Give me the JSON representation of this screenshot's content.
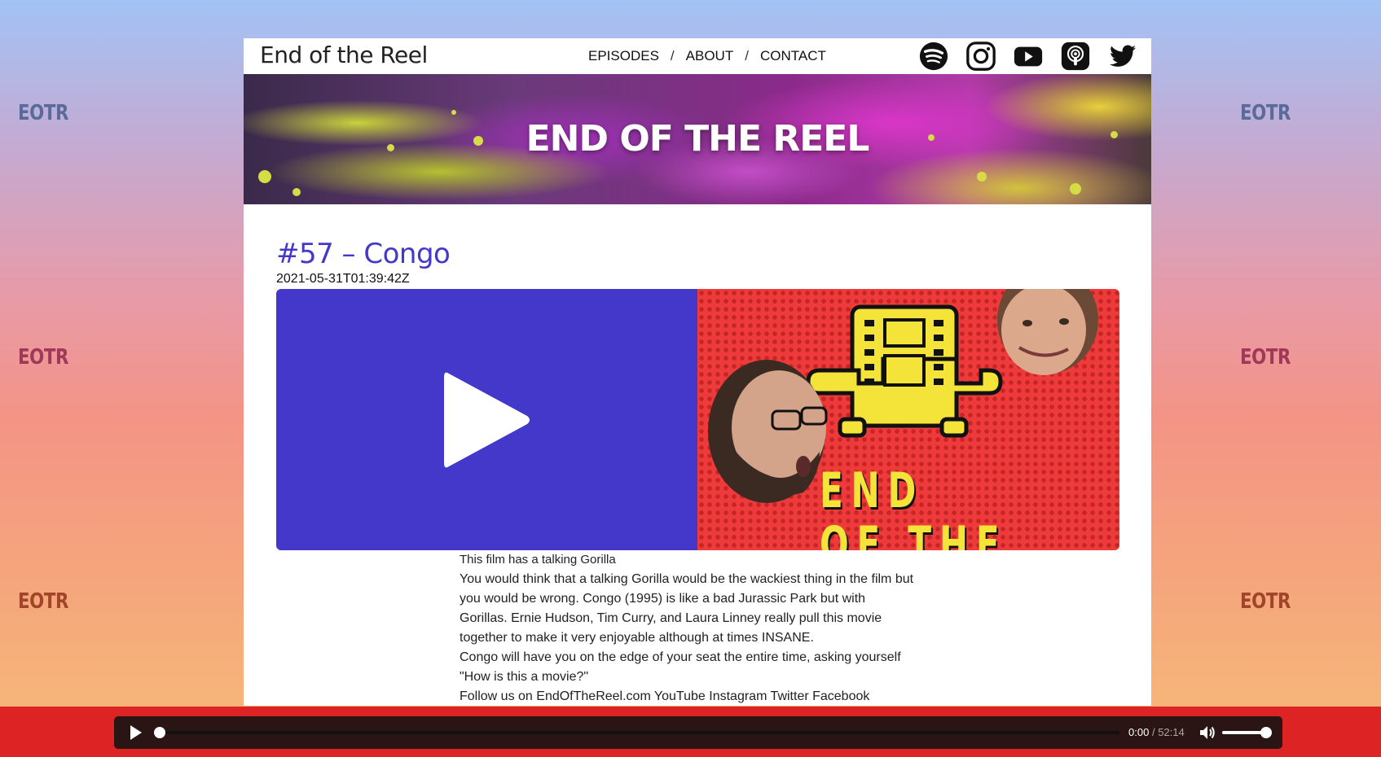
{
  "side_logo": {
    "text": "EOTR"
  },
  "header": {
    "site_title": "End of the Reel",
    "nav": [
      {
        "label": "EPISODES"
      },
      {
        "label": "ABOUT"
      },
      {
        "label": "CONTACT"
      }
    ],
    "nav_separator": "/",
    "social_icons": [
      "spotify-icon",
      "instagram-icon",
      "youtube-icon",
      "apple-podcasts-icon",
      "twitter-icon"
    ]
  },
  "hero": {
    "title": "END OF THE REEL"
  },
  "episode": {
    "title": "#57 – Congo",
    "date": "2021-05-31T01:39:42Z",
    "cover_text": "END\nOF THE",
    "description_lead": "This film has a talking Gorilla",
    "description_paragraphs": [
      "You would think that a talking Gorilla would be the wackiest thing in the film but you would be wrong. Congo (1995) is like a bad Jurassic Park but with Gorillas. Ernie Hudson, Tim Curry, and Laura Linney really pull this movie together to make it very enjoyable although at times INSANE.",
      "Congo will have you on the edge of your seat the entire time, asking yourself \"How is this a movie?\"",
      "Follow us on EndOfTheReel.com YouTube Instagram Twitter Facebook"
    ]
  },
  "player": {
    "current_time": "0:00",
    "time_separator": "/",
    "duration": "52:14",
    "progress_fraction": 0.0,
    "volume_fraction": 1.0
  },
  "colors": {
    "accent": "#4338ca",
    "player_bar": "#dd2323",
    "player_bg": "#2a1414"
  }
}
